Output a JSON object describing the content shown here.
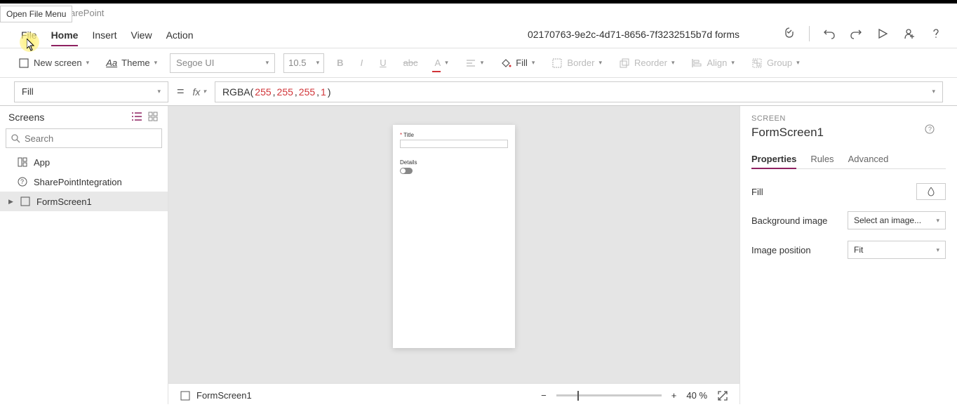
{
  "tooltip": "Open File Menu",
  "breadcrumb": "arePoint",
  "menu": {
    "file": "File",
    "home": "Home",
    "insert": "Insert",
    "view": "View",
    "action": "Action"
  },
  "doc_title": "02170763-9e2c-4d71-8656-7f3232515b7d forms",
  "toolbar": {
    "newscreen": "New screen",
    "theme": "Theme",
    "font": "Segoe UI",
    "size": "10.5",
    "fill": "Fill",
    "border": "Border",
    "reorder": "Reorder",
    "align": "Align",
    "group": "Group"
  },
  "formula": {
    "property": "Fill",
    "expr_fn": "RGBA",
    "v": [
      "255",
      "255",
      "255",
      "1"
    ]
  },
  "tree": {
    "title": "Screens",
    "search_ph": "Search",
    "app": "App",
    "spi": "SharePointIntegration",
    "form": "FormScreen1"
  },
  "canvas": {
    "title_label": "Title",
    "details_label": "Details"
  },
  "rp": {
    "type": "SCREEN",
    "name": "FormScreen1",
    "tabs": {
      "props": "Properties",
      "rules": "Rules",
      "adv": "Advanced"
    },
    "fill": "Fill",
    "bgimg": "Background image",
    "bgimg_val": "Select an image...",
    "imgpos": "Image position",
    "imgpos_val": "Fit"
  },
  "status": {
    "screen": "FormScreen1",
    "zoom": "40",
    "pct": "%"
  }
}
